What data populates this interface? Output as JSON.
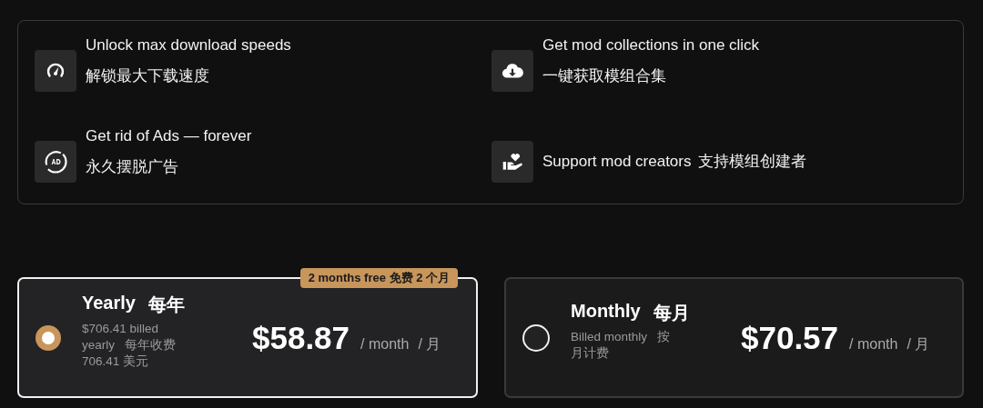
{
  "features": [
    {
      "title": "Unlock max download speeds",
      "subtitle": "解锁最大下载速度",
      "inline": false
    },
    {
      "title": "Get mod collections in one click",
      "subtitle": "一键获取模组合集",
      "inline": false
    },
    {
      "title": "Get rid of Ads — forever",
      "subtitle": "永久摆脱广告",
      "inline": false
    },
    {
      "title": "Support mod creators",
      "subtitle": "支持模组创建者",
      "inline": true
    }
  ],
  "plans": [
    {
      "name": "Yearly",
      "name_zh": "每年",
      "billing": "$706.41 billed yearly   每年收费 706.41 美元",
      "price": "$58.87",
      "per": "/ month",
      "per_zh": "/ 月",
      "badge": "2 months free  免费 2 个月",
      "selected": true
    },
    {
      "name": "Monthly",
      "name_zh": "每月",
      "billing": "Billed monthly   按月计费",
      "price": "$70.57",
      "per": "/ month",
      "per_zh": "/ 月",
      "selected": false
    }
  ]
}
